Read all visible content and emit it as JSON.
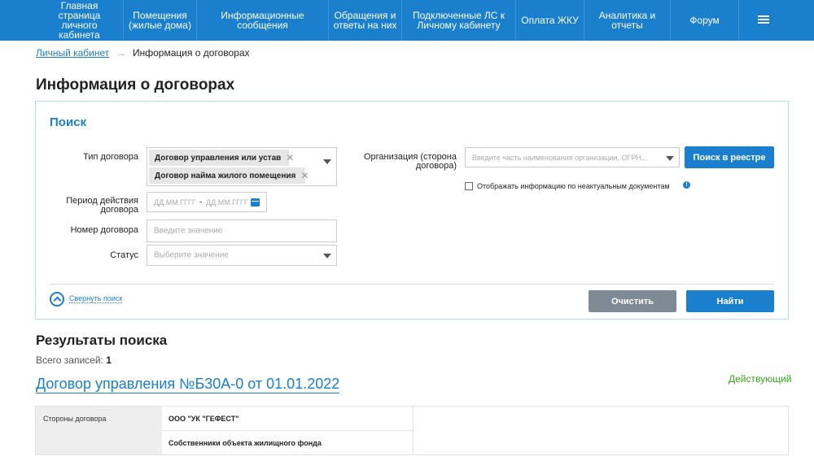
{
  "nav": {
    "items": [
      {
        "label": "Главная страница личного кабинета"
      },
      {
        "label": "Помещения (жилые дома)"
      },
      {
        "label": "Информационные сообщения"
      },
      {
        "label": "Обращения и ответы на них"
      },
      {
        "label": "Подключенные ЛС к Личному кабинету"
      },
      {
        "label": "Оплата ЖКУ"
      },
      {
        "label": "Аналитика и отчеты"
      },
      {
        "label": "Форум"
      }
    ],
    "menu_icon": "hamburger-menu-icon"
  },
  "breadcrumb": {
    "root": "Личный кабинет",
    "separator": "→",
    "current": "Информация о договорах"
  },
  "page_title": "Информация о договорах",
  "search": {
    "title": "Поиск",
    "contract_type": {
      "label": "Тип договора",
      "tags": [
        "Договор управления или устав",
        "Договор найма жилого помещения"
      ]
    },
    "period": {
      "label_line1": "Период действия",
      "label_line2": "договора",
      "from_placeholder": "ДД.ММ.ГГГГ",
      "separator": "-",
      "to_placeholder": "ДД.ММ.ГГГГ"
    },
    "number": {
      "label": "Номер договора",
      "placeholder": "Введите значение"
    },
    "status": {
      "label": "Статус",
      "placeholder": "Выберите значение"
    },
    "organization": {
      "label_line1": "Организация (сторона",
      "label_line2": "договора)",
      "placeholder": "Введите часть наименования организации, ОГРН...",
      "registry_button": "Поиск в реестре"
    },
    "show_outdated_label": "Отображать информацию по неактуальным документам",
    "collapse_link": "Свернуть поиск",
    "clear_button": "Очистить",
    "find_button": "Найти"
  },
  "results": {
    "title": "Результаты поиска",
    "count_label": "Всего записей:",
    "count": "1",
    "items": [
      {
        "title": "Договор управления №Б30А-0 от 01.01.2022",
        "status": "Действующий",
        "parties_label": "Стороны договора",
        "party1": "ООО \"УК \"ГЕФЕСТ\"",
        "party2": "Собственники объекта жилищного фонда"
      }
    ]
  },
  "colors": {
    "primary": "#1a7fcc",
    "active_status": "#3aa31e",
    "clear_button": "#7e8a94"
  }
}
